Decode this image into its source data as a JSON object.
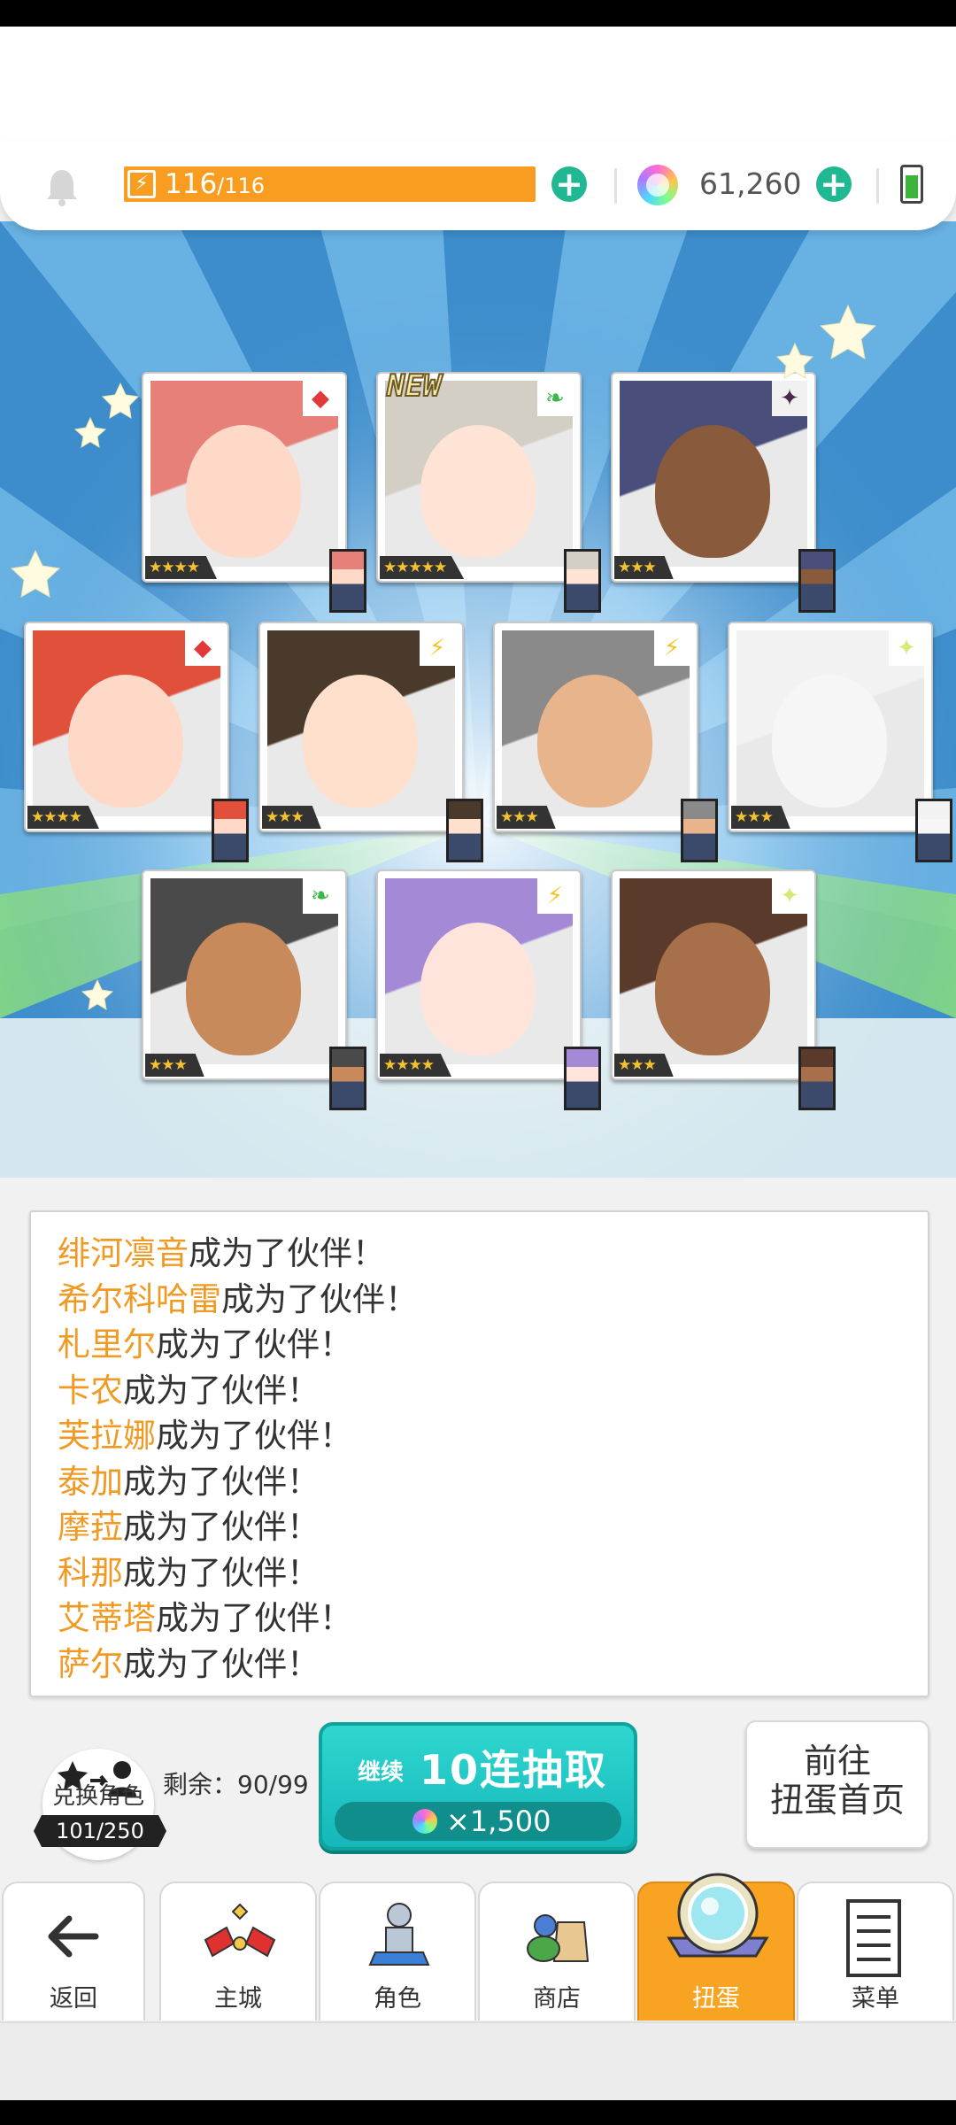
{
  "energy": {
    "current": "116",
    "slash_max": "/116",
    "fraction": 1.0,
    "color": "#f89d1f"
  },
  "gems": {
    "amount": "61,260"
  },
  "cards": [
    {
      "stars": "★★★★",
      "element": "fire",
      "new": false
    },
    {
      "stars": "★★★★★",
      "element": "leaf",
      "new": true,
      "new_label": "NEW"
    },
    {
      "stars": "★★★",
      "element": "dark",
      "new": false
    },
    {
      "stars": "★★★★",
      "element": "fire",
      "new": false
    },
    {
      "stars": "★★★",
      "element": "lightning",
      "new": false
    },
    {
      "stars": "★★★",
      "element": "lightning",
      "new": false
    },
    {
      "stars": "★★★",
      "element": "light",
      "new": false
    },
    {
      "stars": "★★★",
      "element": "leaf",
      "new": false
    },
    {
      "stars": "★★★★",
      "element": "lightning",
      "new": false
    },
    {
      "stars": "★★★",
      "element": "light",
      "new": false
    }
  ],
  "log": {
    "suffix": "成为了伙伴！",
    "lines": [
      {
        "name": "绯河凛音"
      },
      {
        "name": "希尔科哈雷"
      },
      {
        "name": "札里尔"
      },
      {
        "name": "卡农"
      },
      {
        "name": "芙拉娜"
      },
      {
        "name": "泰加"
      },
      {
        "name": "摩菈"
      },
      {
        "name": "科那"
      },
      {
        "name": "艾蒂塔"
      },
      {
        "name": "萨尔"
      }
    ]
  },
  "exchange": {
    "label": "兑换角色",
    "count": "101/250",
    "remaining": "剩余：90/99"
  },
  "pull": {
    "sub": "继续",
    "main": "10连抽取",
    "cost": "×1,500"
  },
  "gacha_home": {
    "line1": "前往",
    "line2": "扭蛋首页"
  },
  "nav": {
    "back": "返回",
    "city": "主城",
    "characters": "角色",
    "shop": "商店",
    "gacha": "扭蛋",
    "menu": "菜单"
  },
  "colors": {
    "accent_orange": "#f89d1f",
    "teal": "#1fb893",
    "name_orange": "#f09a23"
  }
}
